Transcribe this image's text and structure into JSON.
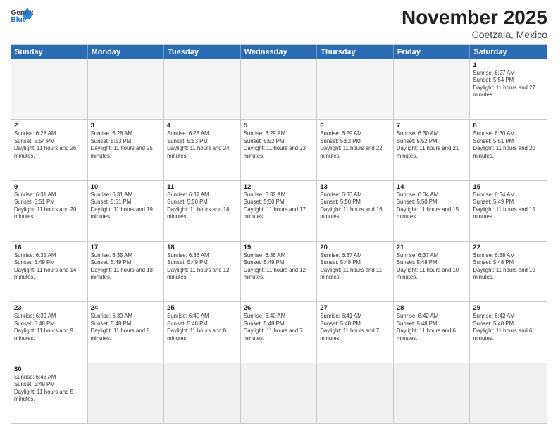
{
  "header": {
    "logo_line1": "General",
    "logo_line2": "Blue",
    "month": "November 2025",
    "location": "Coetzala, Mexico"
  },
  "days_of_week": [
    "Sunday",
    "Monday",
    "Tuesday",
    "Wednesday",
    "Thursday",
    "Friday",
    "Saturday"
  ],
  "rows": [
    [
      {
        "day": "",
        "empty": true
      },
      {
        "day": "",
        "empty": true
      },
      {
        "day": "",
        "empty": true
      },
      {
        "day": "",
        "empty": true
      },
      {
        "day": "",
        "empty": true
      },
      {
        "day": "",
        "empty": true
      },
      {
        "day": "1",
        "sunrise": "6:27 AM",
        "sunset": "5:54 PM",
        "daylight": "11 hours and 27 minutes."
      }
    ],
    [
      {
        "day": "2",
        "sunrise": "6:28 AM",
        "sunset": "5:54 PM",
        "daylight": "11 hours and 26 minutes."
      },
      {
        "day": "3",
        "sunrise": "6:28 AM",
        "sunset": "5:53 PM",
        "daylight": "11 hours and 25 minutes."
      },
      {
        "day": "4",
        "sunrise": "6:28 AM",
        "sunset": "5:53 PM",
        "daylight": "11 hours and 24 minutes."
      },
      {
        "day": "5",
        "sunrise": "6:29 AM",
        "sunset": "5:52 PM",
        "daylight": "11 hours and 23 minutes."
      },
      {
        "day": "6",
        "sunrise": "6:29 AM",
        "sunset": "5:52 PM",
        "daylight": "11 hours and 22 minutes."
      },
      {
        "day": "7",
        "sunrise": "6:30 AM",
        "sunset": "5:52 PM",
        "daylight": "11 hours and 21 minutes."
      },
      {
        "day": "8",
        "sunrise": "6:30 AM",
        "sunset": "5:51 PM",
        "daylight": "11 hours and 20 minutes."
      }
    ],
    [
      {
        "day": "9",
        "sunrise": "6:31 AM",
        "sunset": "5:51 PM",
        "daylight": "11 hours and 20 minutes."
      },
      {
        "day": "10",
        "sunrise": "6:31 AM",
        "sunset": "5:51 PM",
        "daylight": "11 hours and 19 minutes."
      },
      {
        "day": "11",
        "sunrise": "6:32 AM",
        "sunset": "5:50 PM",
        "daylight": "11 hours and 18 minutes."
      },
      {
        "day": "12",
        "sunrise": "6:32 AM",
        "sunset": "5:50 PM",
        "daylight": "11 hours and 17 minutes."
      },
      {
        "day": "13",
        "sunrise": "6:33 AM",
        "sunset": "5:50 PM",
        "daylight": "11 hours and 16 minutes."
      },
      {
        "day": "14",
        "sunrise": "6:34 AM",
        "sunset": "5:50 PM",
        "daylight": "11 hours and 15 minutes."
      },
      {
        "day": "15",
        "sunrise": "6:34 AM",
        "sunset": "5:49 PM",
        "daylight": "11 hours and 15 minutes."
      }
    ],
    [
      {
        "day": "16",
        "sunrise": "6:35 AM",
        "sunset": "5:49 PM",
        "daylight": "11 hours and 14 minutes."
      },
      {
        "day": "17",
        "sunrise": "6:35 AM",
        "sunset": "5:49 PM",
        "daylight": "11 hours and 13 minutes."
      },
      {
        "day": "18",
        "sunrise": "6:36 AM",
        "sunset": "5:49 PM",
        "daylight": "11 hours and 12 minutes."
      },
      {
        "day": "19",
        "sunrise": "6:36 AM",
        "sunset": "5:49 PM",
        "daylight": "11 hours and 12 minutes."
      },
      {
        "day": "20",
        "sunrise": "6:37 AM",
        "sunset": "5:48 PM",
        "daylight": "11 hours and 11 minutes."
      },
      {
        "day": "21",
        "sunrise": "6:37 AM",
        "sunset": "5:48 PM",
        "daylight": "11 hours and 10 minutes."
      },
      {
        "day": "22",
        "sunrise": "6:38 AM",
        "sunset": "5:48 PM",
        "daylight": "11 hours and 10 minutes."
      }
    ],
    [
      {
        "day": "23",
        "sunrise": "6:39 AM",
        "sunset": "5:48 PM",
        "daylight": "11 hours and 9 minutes."
      },
      {
        "day": "24",
        "sunrise": "6:39 AM",
        "sunset": "5:48 PM",
        "daylight": "11 hours and 8 minutes."
      },
      {
        "day": "25",
        "sunrise": "6:40 AM",
        "sunset": "5:48 PM",
        "daylight": "11 hours and 8 minutes."
      },
      {
        "day": "26",
        "sunrise": "6:40 AM",
        "sunset": "5:48 PM",
        "daylight": "11 hours and 7 minutes."
      },
      {
        "day": "27",
        "sunrise": "6:41 AM",
        "sunset": "5:48 PM",
        "daylight": "11 hours and 7 minutes."
      },
      {
        "day": "28",
        "sunrise": "6:42 AM",
        "sunset": "5:48 PM",
        "daylight": "11 hours and 6 minutes."
      },
      {
        "day": "29",
        "sunrise": "6:42 AM",
        "sunset": "5:48 PM",
        "daylight": "11 hours and 6 minutes."
      }
    ],
    [
      {
        "day": "30",
        "sunrise": "6:43 AM",
        "sunset": "5:49 PM",
        "daylight": "11 hours and 5 minutes."
      },
      {
        "day": "",
        "empty": true
      },
      {
        "day": "",
        "empty": true
      },
      {
        "day": "",
        "empty": true
      },
      {
        "day": "",
        "empty": true
      },
      {
        "day": "",
        "empty": true
      },
      {
        "day": "",
        "empty": true
      }
    ]
  ]
}
